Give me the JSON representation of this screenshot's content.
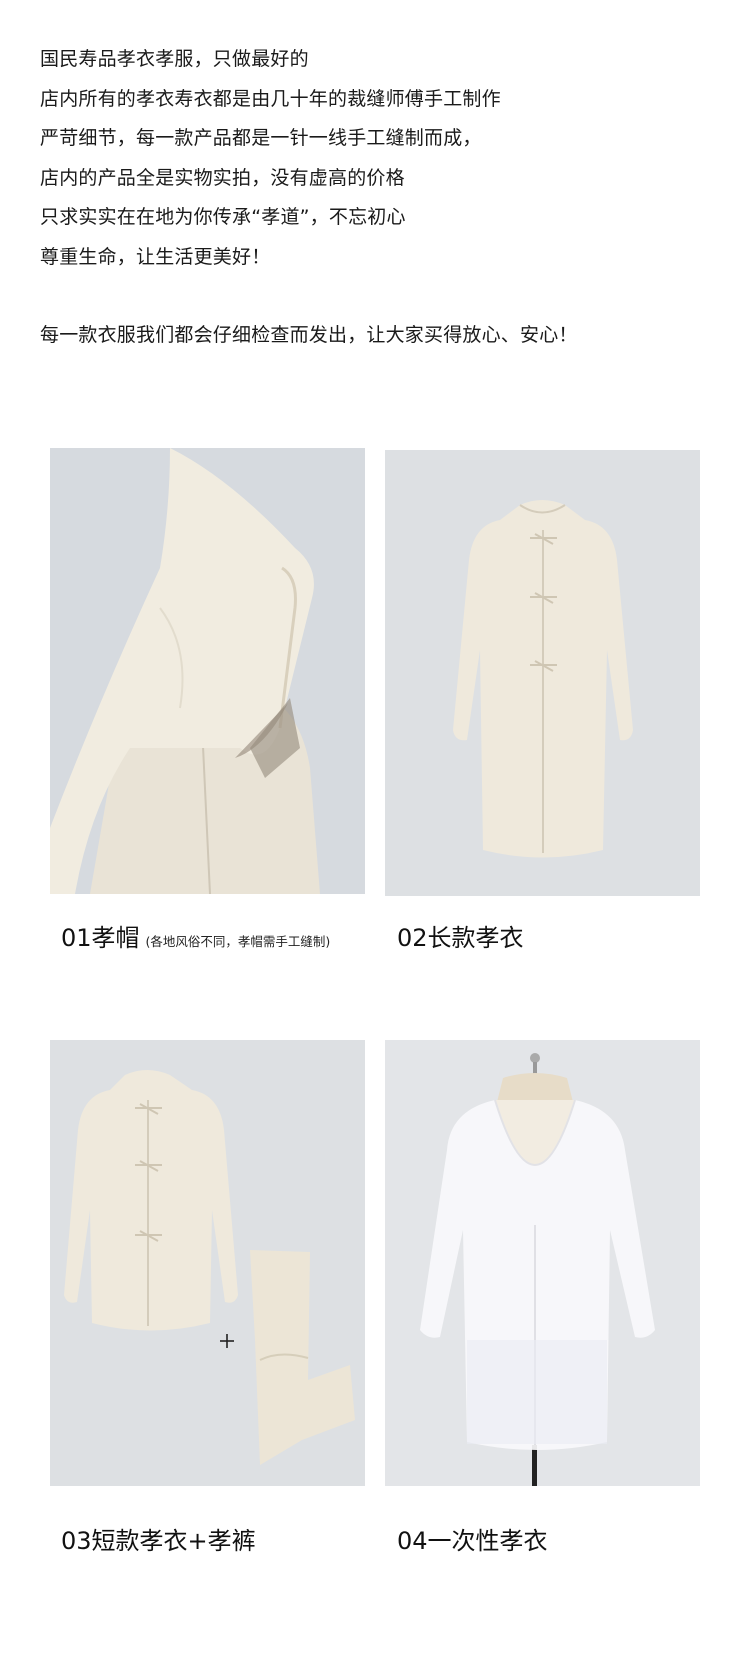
{
  "intro": {
    "lines": [
      "国民寿品孝衣孝服，只做最好的",
      "店内所有的孝衣寿衣都是由几十年的裁缝师傅手工制作",
      "严苛细节，每一款产品都是一针一线手工缝制而成，",
      "店内的产品全是实物实拍，没有虚高的价格",
      "只求实实在在地为你传承“孝道”，不忘初心",
      "尊重生命，让生活更美好！"
    ],
    "closing": "每一款衣服我们都会仔细检查而发出，让大家买得放心、安心！"
  },
  "products": [
    {
      "number": "01",
      "name": "孝帽",
      "note": "(各地风俗不同，孝帽需手工缝制)",
      "image_icon": "mourning-hood-icon"
    },
    {
      "number": "02",
      "name": "长款孝衣",
      "note": "",
      "image_icon": "long-mourning-robe-icon"
    },
    {
      "number": "03",
      "name": "短款孝衣+孝裤",
      "note": "",
      "image_icon": "short-mourning-jacket-and-trousers-icon",
      "plus_sign": "+"
    },
    {
      "number": "04",
      "name": "一次性孝衣",
      "note": "",
      "image_icon": "disposable-mourning-gown-icon"
    }
  ],
  "colors": {
    "background": "#ffffff",
    "photo_backdrop": "#dcdfe2",
    "cloth": "#efe9dc",
    "text": "#1a1a1a"
  }
}
